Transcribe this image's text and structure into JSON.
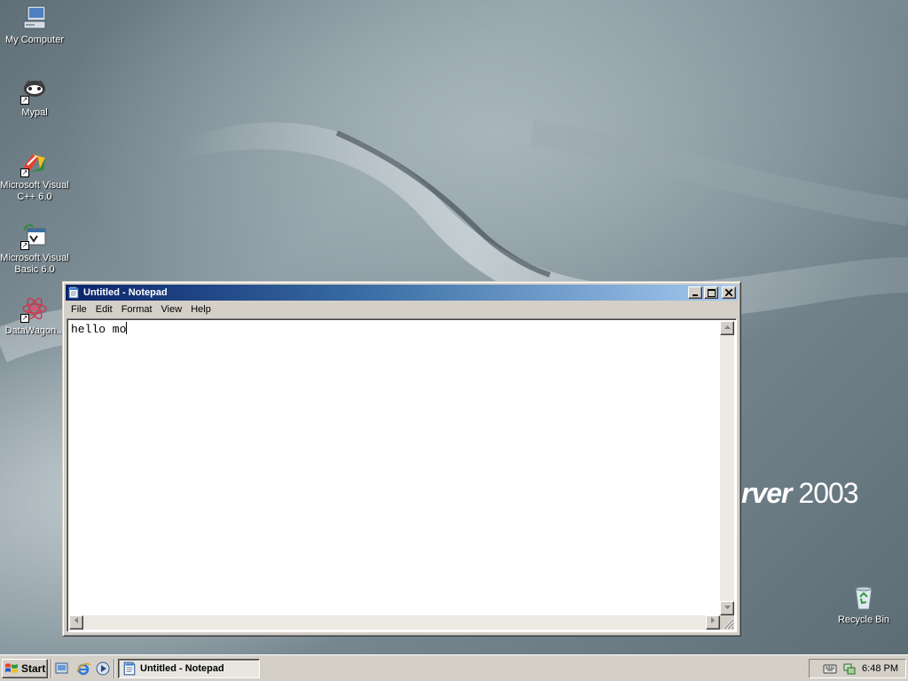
{
  "desktop": {
    "brand_left": "rver",
    "brand_right": "2003",
    "icons": [
      {
        "label": "My Computer"
      },
      {
        "label": "Mypal"
      },
      {
        "label": "Microsoft Visual C++ 6.0"
      },
      {
        "label": "Microsoft Visual Basic 6.0"
      },
      {
        "label": "DataWagon..."
      },
      {
        "label": "Recycle Bin"
      }
    ]
  },
  "window": {
    "title": "Untitled - Notepad",
    "menu": [
      "File",
      "Edit",
      "Format",
      "View",
      "Help"
    ],
    "text": "hello mo"
  },
  "taskbar": {
    "start_label": "Start",
    "task_label": "Untitled - Notepad",
    "clock": "6:48 PM"
  },
  "colors": {
    "titlebar_start": "#0a246a",
    "titlebar_end": "#a6caf0",
    "chrome": "#d4d0c8"
  }
}
